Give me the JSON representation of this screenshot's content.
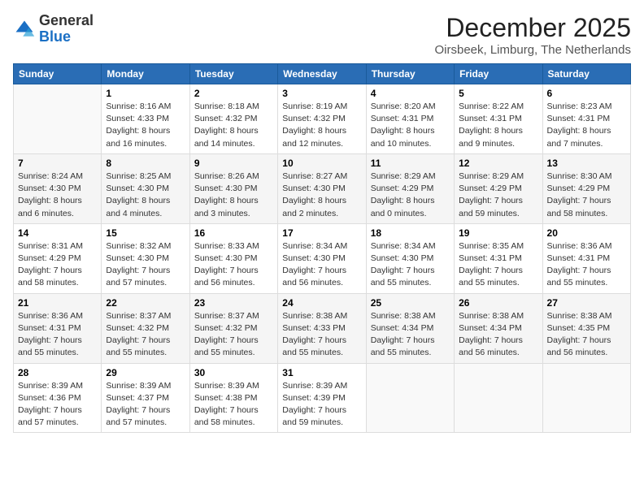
{
  "logo": {
    "general": "General",
    "blue": "Blue"
  },
  "title": "December 2025",
  "location": "Oirsbeek, Limburg, The Netherlands",
  "headers": [
    "Sunday",
    "Monday",
    "Tuesday",
    "Wednesday",
    "Thursday",
    "Friday",
    "Saturday"
  ],
  "weeks": [
    [
      {
        "day": "",
        "info": ""
      },
      {
        "day": "1",
        "info": "Sunrise: 8:16 AM\nSunset: 4:33 PM\nDaylight: 8 hours\nand 16 minutes."
      },
      {
        "day": "2",
        "info": "Sunrise: 8:18 AM\nSunset: 4:32 PM\nDaylight: 8 hours\nand 14 minutes."
      },
      {
        "day": "3",
        "info": "Sunrise: 8:19 AM\nSunset: 4:32 PM\nDaylight: 8 hours\nand 12 minutes."
      },
      {
        "day": "4",
        "info": "Sunrise: 8:20 AM\nSunset: 4:31 PM\nDaylight: 8 hours\nand 10 minutes."
      },
      {
        "day": "5",
        "info": "Sunrise: 8:22 AM\nSunset: 4:31 PM\nDaylight: 8 hours\nand 9 minutes."
      },
      {
        "day": "6",
        "info": "Sunrise: 8:23 AM\nSunset: 4:31 PM\nDaylight: 8 hours\nand 7 minutes."
      }
    ],
    [
      {
        "day": "7",
        "info": "Sunrise: 8:24 AM\nSunset: 4:30 PM\nDaylight: 8 hours\nand 6 minutes."
      },
      {
        "day": "8",
        "info": "Sunrise: 8:25 AM\nSunset: 4:30 PM\nDaylight: 8 hours\nand 4 minutes."
      },
      {
        "day": "9",
        "info": "Sunrise: 8:26 AM\nSunset: 4:30 PM\nDaylight: 8 hours\nand 3 minutes."
      },
      {
        "day": "10",
        "info": "Sunrise: 8:27 AM\nSunset: 4:30 PM\nDaylight: 8 hours\nand 2 minutes."
      },
      {
        "day": "11",
        "info": "Sunrise: 8:29 AM\nSunset: 4:29 PM\nDaylight: 8 hours\nand 0 minutes."
      },
      {
        "day": "12",
        "info": "Sunrise: 8:29 AM\nSunset: 4:29 PM\nDaylight: 7 hours\nand 59 minutes."
      },
      {
        "day": "13",
        "info": "Sunrise: 8:30 AM\nSunset: 4:29 PM\nDaylight: 7 hours\nand 58 minutes."
      }
    ],
    [
      {
        "day": "14",
        "info": "Sunrise: 8:31 AM\nSunset: 4:29 PM\nDaylight: 7 hours\nand 58 minutes."
      },
      {
        "day": "15",
        "info": "Sunrise: 8:32 AM\nSunset: 4:30 PM\nDaylight: 7 hours\nand 57 minutes."
      },
      {
        "day": "16",
        "info": "Sunrise: 8:33 AM\nSunset: 4:30 PM\nDaylight: 7 hours\nand 56 minutes."
      },
      {
        "day": "17",
        "info": "Sunrise: 8:34 AM\nSunset: 4:30 PM\nDaylight: 7 hours\nand 56 minutes."
      },
      {
        "day": "18",
        "info": "Sunrise: 8:34 AM\nSunset: 4:30 PM\nDaylight: 7 hours\nand 55 minutes."
      },
      {
        "day": "19",
        "info": "Sunrise: 8:35 AM\nSunset: 4:31 PM\nDaylight: 7 hours\nand 55 minutes."
      },
      {
        "day": "20",
        "info": "Sunrise: 8:36 AM\nSunset: 4:31 PM\nDaylight: 7 hours\nand 55 minutes."
      }
    ],
    [
      {
        "day": "21",
        "info": "Sunrise: 8:36 AM\nSunset: 4:31 PM\nDaylight: 7 hours\nand 55 minutes."
      },
      {
        "day": "22",
        "info": "Sunrise: 8:37 AM\nSunset: 4:32 PM\nDaylight: 7 hours\nand 55 minutes."
      },
      {
        "day": "23",
        "info": "Sunrise: 8:37 AM\nSunset: 4:32 PM\nDaylight: 7 hours\nand 55 minutes."
      },
      {
        "day": "24",
        "info": "Sunrise: 8:38 AM\nSunset: 4:33 PM\nDaylight: 7 hours\nand 55 minutes."
      },
      {
        "day": "25",
        "info": "Sunrise: 8:38 AM\nSunset: 4:34 PM\nDaylight: 7 hours\nand 55 minutes."
      },
      {
        "day": "26",
        "info": "Sunrise: 8:38 AM\nSunset: 4:34 PM\nDaylight: 7 hours\nand 56 minutes."
      },
      {
        "day": "27",
        "info": "Sunrise: 8:38 AM\nSunset: 4:35 PM\nDaylight: 7 hours\nand 56 minutes."
      }
    ],
    [
      {
        "day": "28",
        "info": "Sunrise: 8:39 AM\nSunset: 4:36 PM\nDaylight: 7 hours\nand 57 minutes."
      },
      {
        "day": "29",
        "info": "Sunrise: 8:39 AM\nSunset: 4:37 PM\nDaylight: 7 hours\nand 57 minutes."
      },
      {
        "day": "30",
        "info": "Sunrise: 8:39 AM\nSunset: 4:38 PM\nDaylight: 7 hours\nand 58 minutes."
      },
      {
        "day": "31",
        "info": "Sunrise: 8:39 AM\nSunset: 4:39 PM\nDaylight: 7 hours\nand 59 minutes."
      },
      {
        "day": "",
        "info": ""
      },
      {
        "day": "",
        "info": ""
      },
      {
        "day": "",
        "info": ""
      }
    ]
  ]
}
